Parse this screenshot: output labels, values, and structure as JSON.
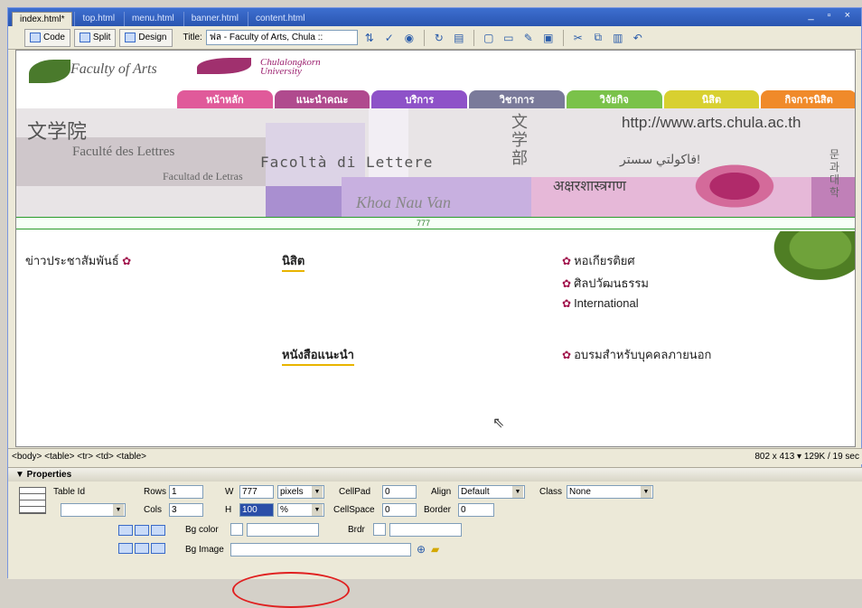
{
  "tabs": [
    {
      "label": "index.html*",
      "active": true
    },
    {
      "label": "top.html",
      "active": false
    },
    {
      "label": "menu.html",
      "active": false
    },
    {
      "label": "banner.html",
      "active": false
    },
    {
      "label": "content.html",
      "active": false
    }
  ],
  "window_controls": "_ ▫ ×",
  "toolbar": {
    "code_label": "Code",
    "split_label": "Split",
    "design_label": "Design",
    "title_label": "Title:",
    "title_value": "ฟล - Faculty of Arts, Chula ::"
  },
  "banner": {
    "logo_text": "Faculty of Arts",
    "logo_chula": "Chulalongkorn",
    "logo_univ": "University",
    "nav_items": [
      {
        "label": "หน้าหลัก",
        "color": "#e05a9a"
      },
      {
        "label": "แนะนำคณะ",
        "color": "#b04a8e"
      },
      {
        "label": "บริการ",
        "color": "#8e52c8"
      },
      {
        "label": "วิชาการ",
        "color": "#7a7a9a"
      },
      {
        "label": "วิจัยกิจ",
        "color": "#7ac24a"
      },
      {
        "label": "นิสิต",
        "color": "#d8d030"
      },
      {
        "label": "กิจการนิสิต",
        "color": "#f08a2a"
      }
    ],
    "chinese": "文学院",
    "french": "Faculté des Lettres",
    "italian": "Facoltà di Lettere",
    "spanish": "Facultad de Letras",
    "vietnamese": "Khoa Nau Van",
    "japanese": "文学部",
    "url": "http://www.arts.chula.ac.th",
    "arabic": "فاكولتي سستر!",
    "hindi": "अक्षरशास्त्रगण",
    "korean": "문과대학",
    "ruler_label": "777"
  },
  "content": {
    "news_label": "ข่าวประชาสัมพันธ์",
    "students_link": "นิสิต",
    "books_link": "หนังสือแนะนำ",
    "right_links": [
      "หอเกียรติยศ",
      "ศิลปวัฒนธรรม",
      "International"
    ],
    "training_link": "อบรมสำหรับบุคคลภายนอก"
  },
  "status": {
    "tag_path": "<body> <table> <tr> <td> <table>",
    "size_info": "802 x 413 ▾ 129K / 19 sec"
  },
  "properties": {
    "header": "▼ Properties",
    "table_id_label": "Table Id",
    "rows_label": "Rows",
    "rows_value": "1",
    "cols_label": "Cols",
    "cols_value": "3",
    "w_label": "W",
    "w_value": "777",
    "w_unit": "pixels",
    "h_label": "H",
    "h_value": "100",
    "h_unit": "%",
    "cellpad_label": "CellPad",
    "cellpad_value": "0",
    "cellspace_label": "CellSpace",
    "cellspace_value": "0",
    "align_label": "Align",
    "align_value": "Default",
    "border_label": "Border",
    "border_value": "0",
    "class_label": "Class",
    "class_value": "None",
    "bgcolor_label": "Bg color",
    "brdr_label": "Brdr",
    "bgimage_label": "Bg Image"
  }
}
